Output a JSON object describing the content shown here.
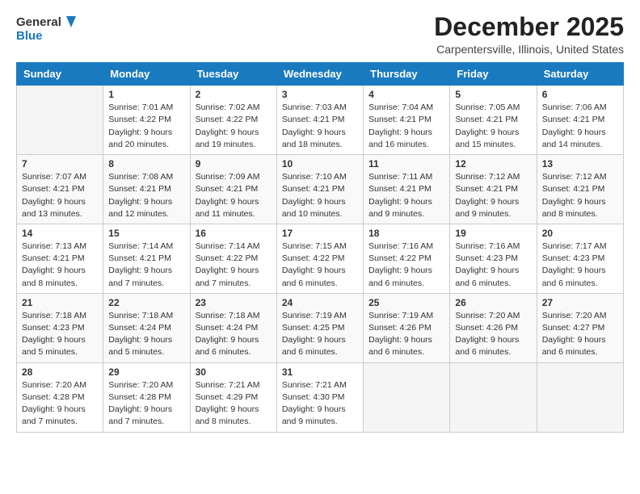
{
  "logo": {
    "line1": "General",
    "line2": "Blue"
  },
  "title": "December 2025",
  "subtitle": "Carpentersville, Illinois, United States",
  "weekdays": [
    "Sunday",
    "Monday",
    "Tuesday",
    "Wednesday",
    "Thursday",
    "Friday",
    "Saturday"
  ],
  "weeks": [
    [
      {
        "day": "",
        "info": ""
      },
      {
        "day": "1",
        "info": "Sunrise: 7:01 AM\nSunset: 4:22 PM\nDaylight: 9 hours\nand 20 minutes."
      },
      {
        "day": "2",
        "info": "Sunrise: 7:02 AM\nSunset: 4:22 PM\nDaylight: 9 hours\nand 19 minutes."
      },
      {
        "day": "3",
        "info": "Sunrise: 7:03 AM\nSunset: 4:21 PM\nDaylight: 9 hours\nand 18 minutes."
      },
      {
        "day": "4",
        "info": "Sunrise: 7:04 AM\nSunset: 4:21 PM\nDaylight: 9 hours\nand 16 minutes."
      },
      {
        "day": "5",
        "info": "Sunrise: 7:05 AM\nSunset: 4:21 PM\nDaylight: 9 hours\nand 15 minutes."
      },
      {
        "day": "6",
        "info": "Sunrise: 7:06 AM\nSunset: 4:21 PM\nDaylight: 9 hours\nand 14 minutes."
      }
    ],
    [
      {
        "day": "7",
        "info": "Sunrise: 7:07 AM\nSunset: 4:21 PM\nDaylight: 9 hours\nand 13 minutes."
      },
      {
        "day": "8",
        "info": "Sunrise: 7:08 AM\nSunset: 4:21 PM\nDaylight: 9 hours\nand 12 minutes."
      },
      {
        "day": "9",
        "info": "Sunrise: 7:09 AM\nSunset: 4:21 PM\nDaylight: 9 hours\nand 11 minutes."
      },
      {
        "day": "10",
        "info": "Sunrise: 7:10 AM\nSunset: 4:21 PM\nDaylight: 9 hours\nand 10 minutes."
      },
      {
        "day": "11",
        "info": "Sunrise: 7:11 AM\nSunset: 4:21 PM\nDaylight: 9 hours\nand 9 minutes."
      },
      {
        "day": "12",
        "info": "Sunrise: 7:12 AM\nSunset: 4:21 PM\nDaylight: 9 hours\nand 9 minutes."
      },
      {
        "day": "13",
        "info": "Sunrise: 7:12 AM\nSunset: 4:21 PM\nDaylight: 9 hours\nand 8 minutes."
      }
    ],
    [
      {
        "day": "14",
        "info": "Sunrise: 7:13 AM\nSunset: 4:21 PM\nDaylight: 9 hours\nand 8 minutes."
      },
      {
        "day": "15",
        "info": "Sunrise: 7:14 AM\nSunset: 4:21 PM\nDaylight: 9 hours\nand 7 minutes."
      },
      {
        "day": "16",
        "info": "Sunrise: 7:14 AM\nSunset: 4:22 PM\nDaylight: 9 hours\nand 7 minutes."
      },
      {
        "day": "17",
        "info": "Sunrise: 7:15 AM\nSunset: 4:22 PM\nDaylight: 9 hours\nand 6 minutes."
      },
      {
        "day": "18",
        "info": "Sunrise: 7:16 AM\nSunset: 4:22 PM\nDaylight: 9 hours\nand 6 minutes."
      },
      {
        "day": "19",
        "info": "Sunrise: 7:16 AM\nSunset: 4:23 PM\nDaylight: 9 hours\nand 6 minutes."
      },
      {
        "day": "20",
        "info": "Sunrise: 7:17 AM\nSunset: 4:23 PM\nDaylight: 9 hours\nand 6 minutes."
      }
    ],
    [
      {
        "day": "21",
        "info": "Sunrise: 7:18 AM\nSunset: 4:23 PM\nDaylight: 9 hours\nand 5 minutes."
      },
      {
        "day": "22",
        "info": "Sunrise: 7:18 AM\nSunset: 4:24 PM\nDaylight: 9 hours\nand 5 minutes."
      },
      {
        "day": "23",
        "info": "Sunrise: 7:18 AM\nSunset: 4:24 PM\nDaylight: 9 hours\nand 6 minutes."
      },
      {
        "day": "24",
        "info": "Sunrise: 7:19 AM\nSunset: 4:25 PM\nDaylight: 9 hours\nand 6 minutes."
      },
      {
        "day": "25",
        "info": "Sunrise: 7:19 AM\nSunset: 4:26 PM\nDaylight: 9 hours\nand 6 minutes."
      },
      {
        "day": "26",
        "info": "Sunrise: 7:20 AM\nSunset: 4:26 PM\nDaylight: 9 hours\nand 6 minutes."
      },
      {
        "day": "27",
        "info": "Sunrise: 7:20 AM\nSunset: 4:27 PM\nDaylight: 9 hours\nand 6 minutes."
      }
    ],
    [
      {
        "day": "28",
        "info": "Sunrise: 7:20 AM\nSunset: 4:28 PM\nDaylight: 9 hours\nand 7 minutes."
      },
      {
        "day": "29",
        "info": "Sunrise: 7:20 AM\nSunset: 4:28 PM\nDaylight: 9 hours\nand 7 minutes."
      },
      {
        "day": "30",
        "info": "Sunrise: 7:21 AM\nSunset: 4:29 PM\nDaylight: 9 hours\nand 8 minutes."
      },
      {
        "day": "31",
        "info": "Sunrise: 7:21 AM\nSunset: 4:30 PM\nDaylight: 9 hours\nand 9 minutes."
      },
      {
        "day": "",
        "info": ""
      },
      {
        "day": "",
        "info": ""
      },
      {
        "day": "",
        "info": ""
      }
    ]
  ]
}
